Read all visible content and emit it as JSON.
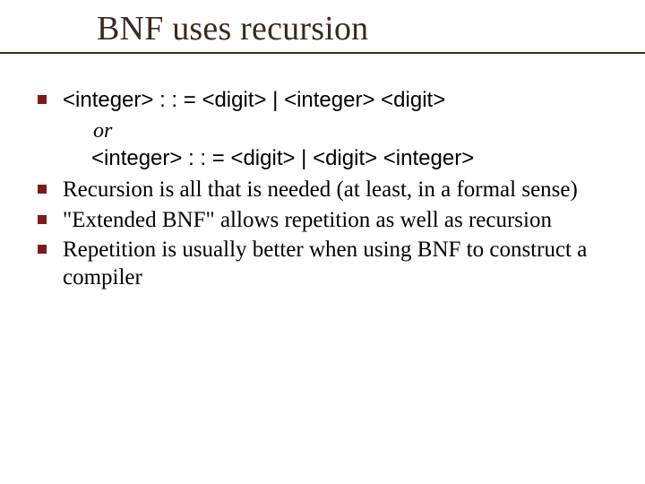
{
  "title": "BNF uses recursion",
  "grammar": {
    "line1": "<integer> : : = <digit> | <integer> <digit>",
    "or": "or",
    "line2": "<integer> : : = <digit> | <digit> <integer>"
  },
  "points": {
    "p1": "Recursion is all that is needed (at least, in a formal sense)",
    "p2": "\"Extended BNF\" allows repetition as well as recursion",
    "p3": "Repetition is usually better when using BNF to construct a compiler"
  }
}
